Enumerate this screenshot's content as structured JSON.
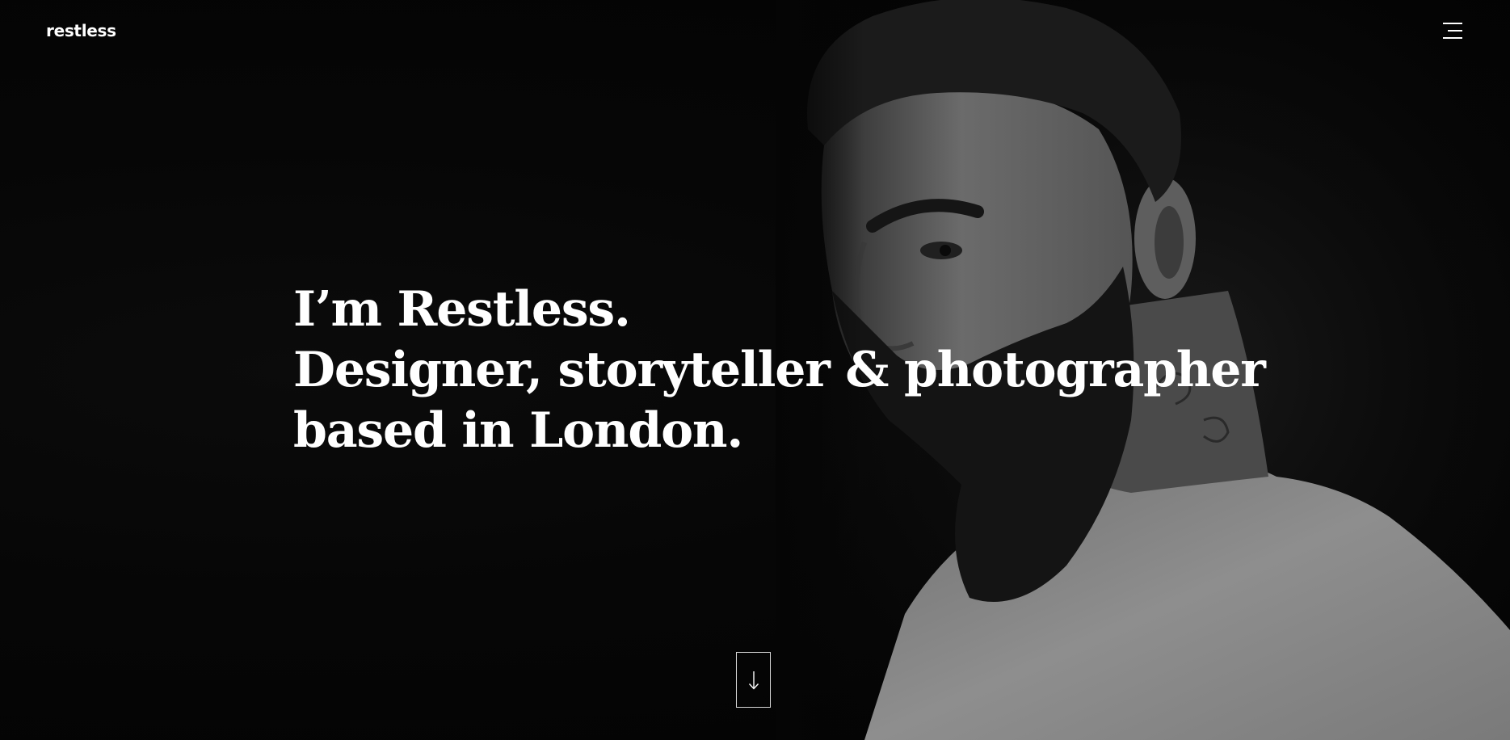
{
  "header": {
    "logo_text": "restless",
    "menu_icon": "hamburger-menu-icon"
  },
  "hero": {
    "headline_lines": [
      "I’m Restless.",
      "Designer, storyteller & photographer",
      "based in London."
    ],
    "scroll_icon": "arrow-down-icon",
    "image": "bearded-man-portrait"
  },
  "colors": {
    "background": "#050505",
    "text": "#ffffff",
    "portrait_tone": "#8a8a8a"
  }
}
